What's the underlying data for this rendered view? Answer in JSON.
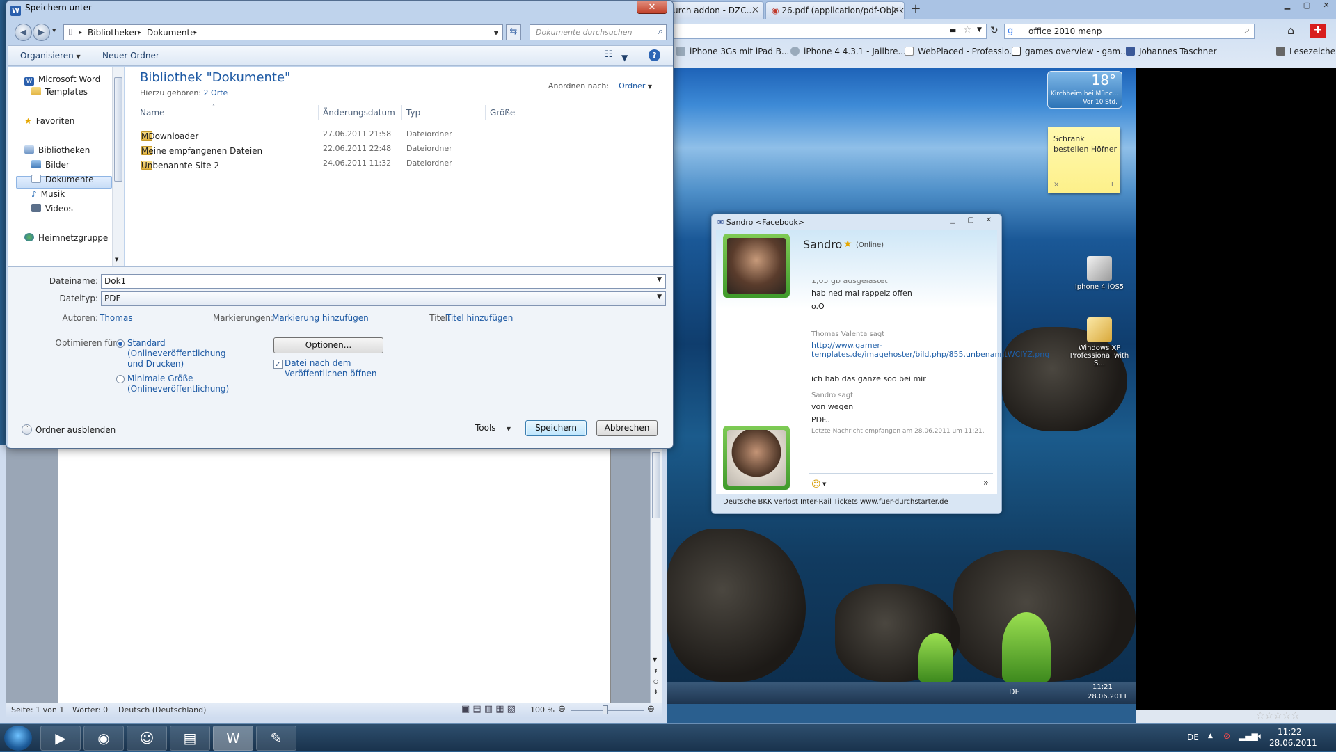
{
  "dialog": {
    "title": "Speichern unter",
    "close_glyph": "✕",
    "breadcrumb": [
      "Bibliotheken",
      "Dokumente"
    ],
    "search_placeholder": "Dokumente durchsuchen",
    "toolbar": {
      "organize": "Organisieren",
      "new_folder": "Neuer Ordner"
    },
    "nav": {
      "app": "Microsoft Word",
      "templates": "Templates",
      "favorites": "Favoriten",
      "libraries": "Bibliotheken",
      "pictures": "Bilder",
      "documents": "Dokumente",
      "music": "Musik",
      "videos": "Videos",
      "homegroup": "Heimnetzgruppe"
    },
    "library": {
      "title": "Bibliothek \"Dokumente\"",
      "includes_label": "Hierzu gehören:",
      "includes_link": "2 Orte",
      "arrange_label": "Anordnen nach:",
      "arrange_value": "Ordner"
    },
    "columns": {
      "name": "Name",
      "date": "Änderungsdatum",
      "type": "Typ",
      "size": "Größe"
    },
    "files": [
      {
        "name": "MDownloader",
        "date": "27.06.2011 21:58",
        "type": "Dateiordner"
      },
      {
        "name": "Meine empfangenen Dateien",
        "date": "22.06.2011 22:48",
        "type": "Dateiordner"
      },
      {
        "name": "Unbenannte Site 2",
        "date": "24.06.2011 11:32",
        "type": "Dateiordner"
      }
    ],
    "fields": {
      "filename_label": "Dateiname:",
      "filename_value": "Dok1",
      "filetype_label": "Dateityp:",
      "filetype_value": "PDF",
      "authors_label": "Autoren:",
      "authors_value": "Thomas",
      "tags_label": "Markierungen:",
      "tags_value": "Markierung hinzufügen",
      "title_label": "Titel:",
      "title_value": "Titel hinzufügen",
      "optimize_label": "Optimieren für:",
      "opt_standard": "Standard (Onlineveröffentlichung und Drucken)",
      "opt_minimal": "Minimale Größe (Onlineveröffentlichung)",
      "options_button": "Optionen...",
      "open_after": "Datei nach dem Veröffentlichen öffnen"
    },
    "footer": {
      "hide_folders": "Ordner ausblenden",
      "tools": "Tools",
      "save": "Speichern",
      "cancel": "Abbrechen"
    }
  },
  "word_status": {
    "page": "Seite: 1 von 1",
    "words": "Wörter: 0",
    "language": "Deutsch (Deutschland)",
    "zoom": "100 %"
  },
  "browser": {
    "tabs": [
      "urch addon - DZC...",
      "26.pdf (application/pdf-Objekt)"
    ],
    "search_value": "office 2010 menp",
    "bookmarks": [
      "iPhone 3Gs mit iPad B...",
      "iPhone 4 4.3.1 - Jailbre...",
      "WebPlaced - Professio...",
      "games overview - gam...",
      "Johannes Taschner",
      "Lesezeichen"
    ]
  },
  "weather": {
    "temp": "18°",
    "location": "Kirchheim bei Münc...",
    "age": "Vor 10 Std."
  },
  "sticky_note": {
    "line1": "Schrank",
    "line2": "bestellen Höfner"
  },
  "desktop_icons": [
    {
      "label": "Iphone 4 iOS5"
    },
    {
      "label": "Windows XP Professional with S..."
    }
  ],
  "chat": {
    "window_title": "Sandro <Facebook>",
    "contact_name": "Sandro",
    "status": "(Online)",
    "messages": {
      "partial": "1,05 gb ausgelastet",
      "m1": "hab ned mal rappelz offen",
      "m2": "o.O",
      "sender1": "Thomas Valenta sagt",
      "link": "http://www.gamer-templates.de/imagehoster/bild.php/855.unbenanntWCIYZ.png",
      "m3": "ich hab das ganze soo bei mir",
      "sender2": "Sandro sagt",
      "m4": "von wegen",
      "m5": "PDF..",
      "last": "Letzte Nachricht empfangen am 28.06.2011 um 11:21."
    },
    "footer": "Deutsche BKK verlost Inter-Rail Tickets www.fuer-durchstarter.de"
  },
  "tray": {
    "lang": "DE",
    "time": "11:22",
    "date": "28.06.2011",
    "inner_time": "11:21",
    "inner_date": "28.06.2011"
  }
}
